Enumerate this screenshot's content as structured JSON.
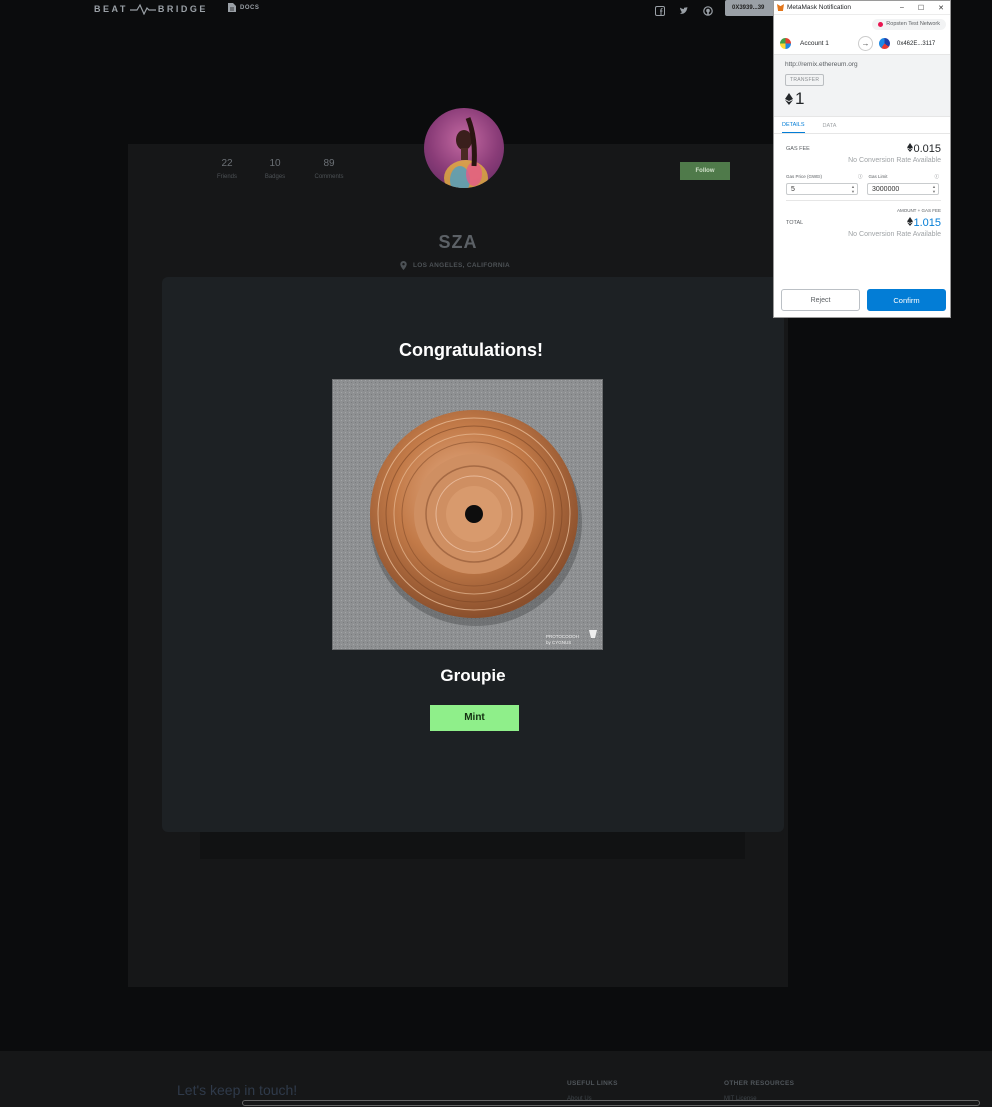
{
  "nav": {
    "brand_left": "BEAT",
    "brand_right": "BRIDGE",
    "docs_label": "DOCS",
    "wallet_address": "0X3939...39",
    "social_icons": [
      "facebook-icon",
      "twitter-icon",
      "github-icon"
    ]
  },
  "profile": {
    "stats": [
      {
        "value": "22",
        "label": "Friends"
      },
      {
        "value": "10",
        "label": "Badges"
      },
      {
        "value": "89",
        "label": "Comments"
      }
    ],
    "follow_label": "Follow",
    "name": "SZA",
    "location": "LOS ANGELES, CALIFORNIA"
  },
  "modal": {
    "heading": "Congratulations!",
    "badge_title": "Groupie",
    "mint_label": "Mint",
    "watermark_line1": "PROTOCOOOH",
    "watermark_line2": "by CYGNUS"
  },
  "footer": {
    "tagline": "Let's keep in touch!",
    "useful_links_heading": "USEFUL LINKS",
    "useful_link_first": "About Us",
    "other_resources_heading": "OTHER RESOURCES",
    "other_resource_first": "MIT License"
  },
  "metamask": {
    "window_title": "MetaMask Notification",
    "network": "Ropsten Test Network",
    "from_account": "Account 1",
    "to_account": "0x462E...3117",
    "origin": "http://remix.ethereum.org",
    "action": "TRANSFER",
    "amount": "1",
    "tabs": [
      "DETAILS",
      "DATA"
    ],
    "gas_fee_label": "GAS FEE",
    "gas_fee_value": "0.015",
    "no_conversion": "No Conversion Rate Available",
    "gas_price_label": "Gas Price (GWEI)",
    "gas_limit_label": "Gas Limit",
    "gas_price_value": "5",
    "gas_limit_value": "3000000",
    "amount_gas_label": "AMOUNT + GAS FEE",
    "total_label": "TOTAL",
    "total_value": "1.015",
    "reject_label": "Reject",
    "confirm_label": "Confirm",
    "accent_color": "#037dd6"
  }
}
